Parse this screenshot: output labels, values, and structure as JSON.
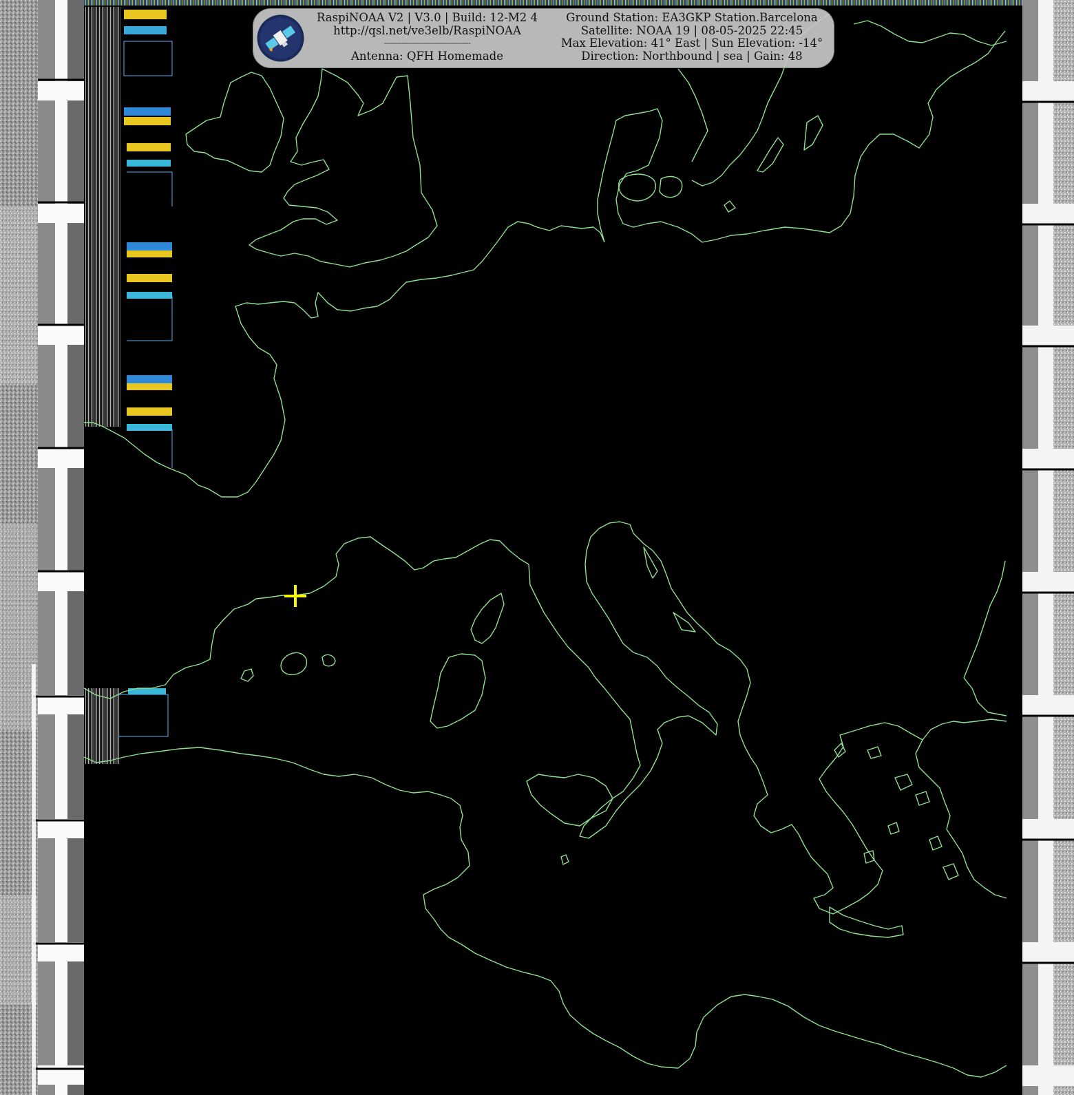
{
  "header": {
    "left_lines": [
      "RaspiNOAA V2 | V3.0 | Build: 12-M2 4",
      "http://qsl.net/ve3elb/RaspiNOAA",
      "---------------------------------------",
      "Antenna: QFH Homemade"
    ],
    "right_lines": [
      "Ground Station: EA3GKP Station.Barcelona",
      "Satellite: NOAA 19 | 08-05-2025 22:45",
      "Max Elevation: 41° East | Sun Elevation: -14°",
      "Direction: Northbound | sea | Gain: 48"
    ]
  },
  "map": {
    "background_color": "#000000",
    "coastline_color": "#8fe08f",
    "marker_color": "#f5f500",
    "marker_icon": "crosshair-plus-icon",
    "logo_icon": "satellite-logo-icon"
  }
}
